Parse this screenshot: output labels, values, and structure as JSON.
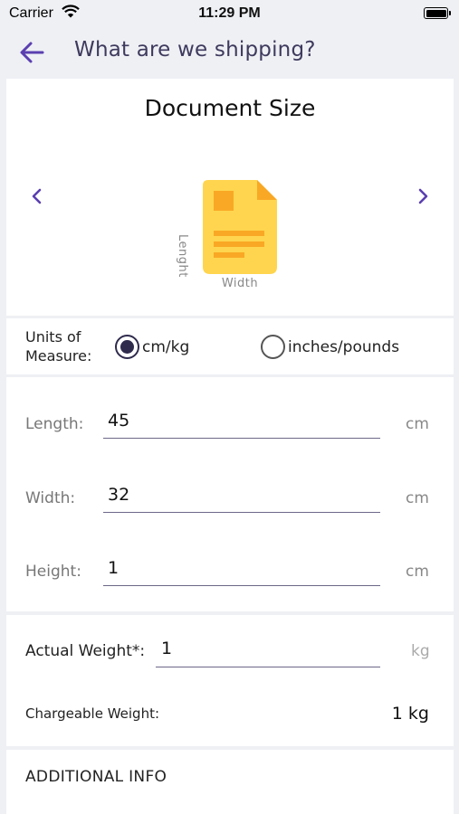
{
  "status": {
    "carrier": "Carrier",
    "time": "11:29 PM"
  },
  "nav": {
    "title": "What are we shipping?",
    "back_icon": "arrow-left-icon"
  },
  "document": {
    "title": "Document Size",
    "length_label": "Lenght",
    "width_label": "Width",
    "icon_color": "#ffd54f"
  },
  "units": {
    "label": "Units of Measure:",
    "options": [
      "cm/kg",
      "inches/pounds"
    ],
    "selected": "cm/kg"
  },
  "dimensions": {
    "length": {
      "label": "Length:",
      "value": "45",
      "unit": "cm"
    },
    "width": {
      "label": "Width:",
      "value": "32",
      "unit": "cm"
    },
    "height": {
      "label": "Height:",
      "value": "1",
      "unit": "cm"
    }
  },
  "weight": {
    "actual_label": "Actual Weight*:",
    "actual_value": "1",
    "actual_unit": "kg",
    "chargeable_label": "Chargeable Weight:",
    "chargeable_value": "1 kg"
  },
  "additional": {
    "label": "ADDITIONAL INFO"
  },
  "colors": {
    "accent": "#5b3fb0",
    "background": "#eef0f4",
    "document_yellow": "#ffd54f",
    "document_detail": "#f9a825"
  }
}
